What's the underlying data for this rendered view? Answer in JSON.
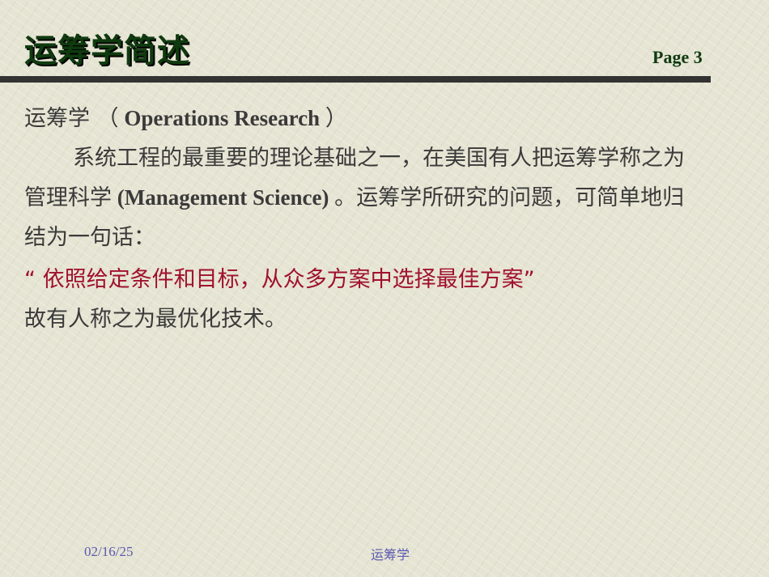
{
  "header": {
    "title": "运筹学简述",
    "page": "Page 3"
  },
  "body": {
    "line1_cn": "运筹学 （",
    "line1_en": " Operations Research ",
    "line1_end": "）",
    "para_a": "系统工程的最重要的理论基础之一，在美国有人把运筹学称之为管理科学",
    "para_en": " (Management Science) ",
    "para_b": "。运筹学所研究的问题，可简单地归结为一句话：",
    "quote": "“ 依照给定条件和目标，从众多方案中选择最佳方案”",
    "closing": "故有人称之为最优化技术。"
  },
  "footer": {
    "date": "02/16/25",
    "center": "运筹学"
  }
}
